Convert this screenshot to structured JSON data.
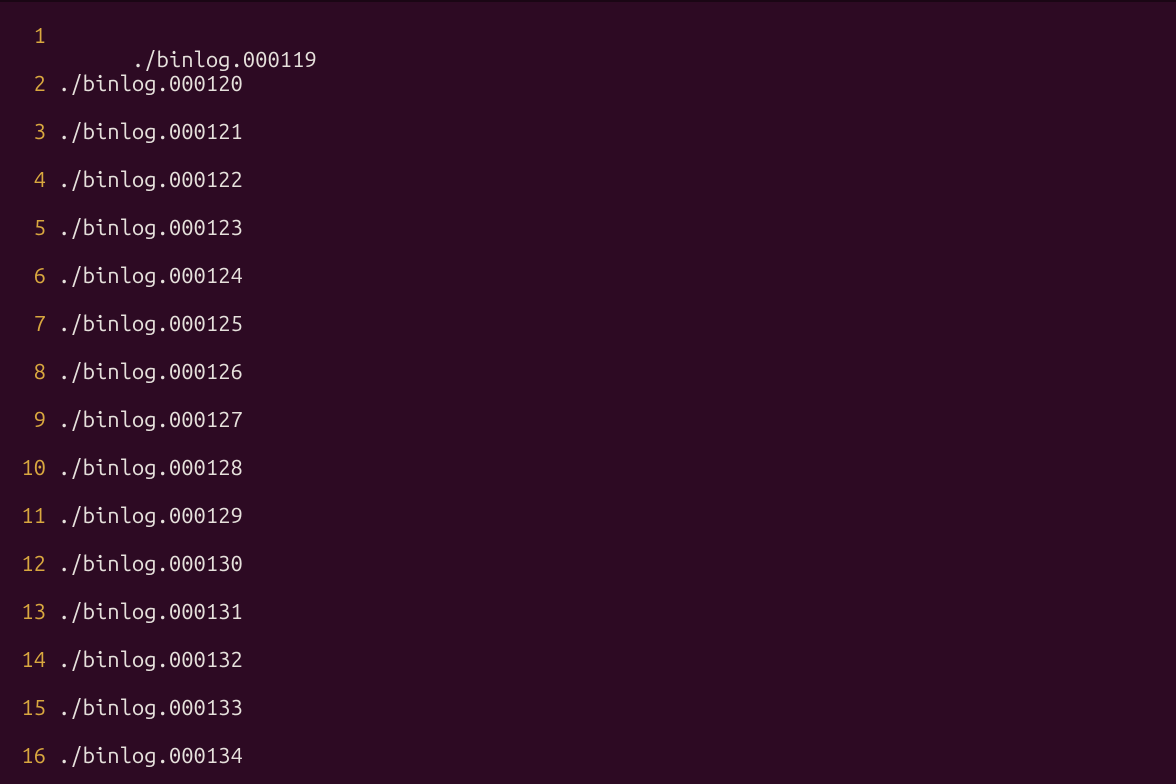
{
  "editor": {
    "lines": [
      {
        "number": "1",
        "text": "./binlog.000119"
      },
      {
        "number": "2",
        "text": "./binlog.000120"
      },
      {
        "number": "3",
        "text": "./binlog.000121"
      },
      {
        "number": "4",
        "text": "./binlog.000122"
      },
      {
        "number": "5",
        "text": "./binlog.000123"
      },
      {
        "number": "6",
        "text": "./binlog.000124"
      },
      {
        "number": "7",
        "text": "./binlog.000125"
      },
      {
        "number": "8",
        "text": "./binlog.000126"
      },
      {
        "number": "9",
        "text": "./binlog.000127"
      },
      {
        "number": "10",
        "text": "./binlog.000128"
      },
      {
        "number": "11",
        "text": "./binlog.000129"
      },
      {
        "number": "12",
        "text": "./binlog.000130"
      },
      {
        "number": "13",
        "text": "./binlog.000131"
      },
      {
        "number": "14",
        "text": "./binlog.000132"
      },
      {
        "number": "15",
        "text": "./binlog.000133"
      },
      {
        "number": "16",
        "text": "./binlog.000134"
      }
    ],
    "cursor_line": 0,
    "cursor_col": 0
  },
  "colors": {
    "background": "#2d0a23",
    "gutter": "#d9a83f",
    "text": "#e6e1dc"
  }
}
